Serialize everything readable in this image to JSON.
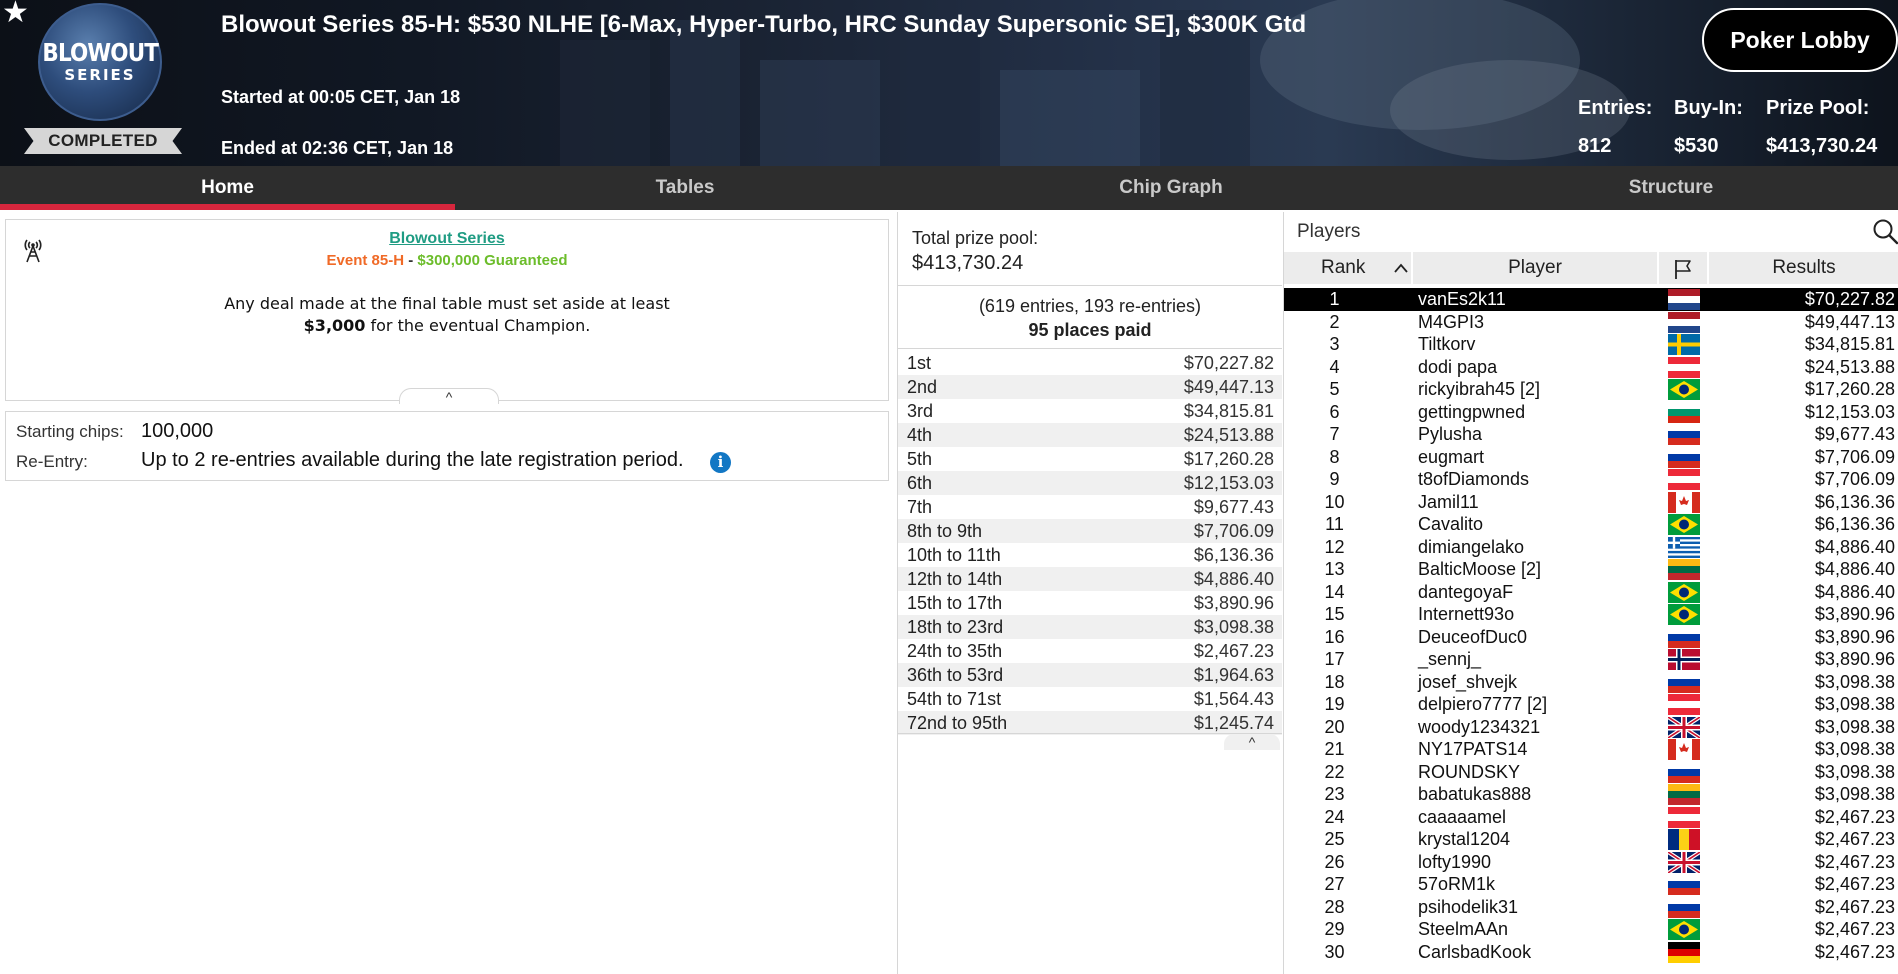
{
  "header": {
    "logo_top": "BLOWOUT",
    "logo_bottom": "SERIES",
    "status": "COMPLETED",
    "title": "Blowout Series 85-H: $530 NLHE [6-Max, Hyper-Turbo, HRC Sunday Supersonic SE], $300K Gtd",
    "started": "Started at 00:05 CET, Jan 18",
    "ended": "Ended at 02:36 CET, Jan 18",
    "lobby_button": "Poker Lobby",
    "stats": {
      "entries_label": "Entries:",
      "entries_value": "812",
      "buyin_label": "Buy-In:",
      "buyin_value": "$530",
      "prizepool_label": "Prize Pool:",
      "prizepool_value": "$413,730.24"
    }
  },
  "nav": {
    "tabs": [
      {
        "label": "Home",
        "active": true
      },
      {
        "label": "Tables",
        "active": false
      },
      {
        "label": "Chip Graph",
        "active": false
      },
      {
        "label": "Structure",
        "active": false
      }
    ]
  },
  "info": {
    "series_link": "Blowout Series",
    "event_name": "Event 85-H",
    "event_sep": " - ",
    "guarantee": "$300,000 Guaranteed",
    "deal_line1": "Any deal made at the final table must set aside at least",
    "deal_amount": "$3,000",
    "deal_line2": " for the eventual Champion.",
    "collapse_glyph": "^"
  },
  "details": {
    "starting_chips_label": "Starting chips:",
    "starting_chips_value": "100,000",
    "reentry_label": "Re-Entry:",
    "reentry_value": "Up to 2 re-entries available during the late registration period.",
    "info_glyph": "i"
  },
  "prize": {
    "total_label": "Total prize pool:",
    "total_value": "$413,730.24",
    "entries_text": "(619 entries, 193 re-entries)",
    "places_paid": "95 places paid",
    "collapse_glyph": "^",
    "payouts": [
      {
        "place": "1st",
        "amount": "$70,227.82"
      },
      {
        "place": "2nd",
        "amount": "$49,447.13"
      },
      {
        "place": "3rd",
        "amount": "$34,815.81"
      },
      {
        "place": "4th",
        "amount": "$24,513.88"
      },
      {
        "place": "5th",
        "amount": "$17,260.28"
      },
      {
        "place": "6th",
        "amount": "$12,153.03"
      },
      {
        "place": "7th",
        "amount": "$9,677.43"
      },
      {
        "place": "8th to 9th",
        "amount": "$7,706.09"
      },
      {
        "place": "10th to 11th",
        "amount": "$6,136.36"
      },
      {
        "place": "12th to 14th",
        "amount": "$4,886.40"
      },
      {
        "place": "15th to 17th",
        "amount": "$3,890.96"
      },
      {
        "place": "18th to 23rd",
        "amount": "$3,098.38"
      },
      {
        "place": "24th to 35th",
        "amount": "$2,467.23"
      },
      {
        "place": "36th to 53rd",
        "amount": "$1,964.63"
      },
      {
        "place": "54th to 71st",
        "amount": "$1,564.43"
      },
      {
        "place": "72nd to 95th",
        "amount": "$1,245.74"
      }
    ]
  },
  "players": {
    "label": "Players",
    "columns": {
      "rank": "Rank",
      "player": "Player",
      "results": "Results"
    },
    "rows": [
      {
        "rank": "1",
        "name": "vanEs2k11",
        "flag": "NL",
        "result": "$70,227.82",
        "selected": true
      },
      {
        "rank": "2",
        "name": "M4GPI3",
        "flag": "NL",
        "result": "$49,447.13"
      },
      {
        "rank": "3",
        "name": "Tiltkorv",
        "flag": "SE",
        "result": "$34,815.81"
      },
      {
        "rank": "4",
        "name": "dodi papa",
        "flag": "AT",
        "result": "$24,513.88"
      },
      {
        "rank": "5",
        "name": "rickyibrah45 [2]",
        "flag": "BR",
        "result": "$17,260.28"
      },
      {
        "rank": "6",
        "name": "gettingpwned",
        "flag": "BG",
        "result": "$12,153.03"
      },
      {
        "rank": "7",
        "name": "Pylusha",
        "flag": "RU",
        "result": "$9,677.43"
      },
      {
        "rank": "8",
        "name": "eugmart",
        "flag": "RU",
        "result": "$7,706.09"
      },
      {
        "rank": "9",
        "name": "t8ofDiamonds",
        "flag": "AT",
        "result": "$7,706.09"
      },
      {
        "rank": "10",
        "name": "Jamil11",
        "flag": "CA",
        "result": "$6,136.36"
      },
      {
        "rank": "11",
        "name": "Cavalito",
        "flag": "BR",
        "result": "$6,136.36"
      },
      {
        "rank": "12",
        "name": "dimiangelako",
        "flag": "GR",
        "result": "$4,886.40"
      },
      {
        "rank": "13",
        "name": "BalticMoose [2]",
        "flag": "LT",
        "result": "$4,886.40"
      },
      {
        "rank": "14",
        "name": "dantegoyaF",
        "flag": "BR",
        "result": "$4,886.40"
      },
      {
        "rank": "15",
        "name": "Internett93o",
        "flag": "BR",
        "result": "$3,890.96"
      },
      {
        "rank": "16",
        "name": "DeuceofDuc0",
        "flag": "RU",
        "result": "$3,890.96"
      },
      {
        "rank": "17",
        "name": "_sennj_",
        "flag": "NO",
        "result": "$3,890.96"
      },
      {
        "rank": "18",
        "name": "josef_shvejk",
        "flag": "RU",
        "result": "$3,098.38"
      },
      {
        "rank": "19",
        "name": "delpiero7777 [2]",
        "flag": "AT",
        "result": "$3,098.38"
      },
      {
        "rank": "20",
        "name": "woody1234321",
        "flag": "GB",
        "result": "$3,098.38"
      },
      {
        "rank": "21",
        "name": "NY17PATS14",
        "flag": "CA",
        "result": "$3,098.38"
      },
      {
        "rank": "22",
        "name": "ROUNDSKY",
        "flag": "RU",
        "result": "$3,098.38"
      },
      {
        "rank": "23",
        "name": "babatukas888",
        "flag": "LT",
        "result": "$3,098.38"
      },
      {
        "rank": "24",
        "name": "caaaaamel",
        "flag": "AT",
        "result": "$2,467.23"
      },
      {
        "rank": "25",
        "name": "krystal1204",
        "flag": "RO",
        "result": "$2,467.23"
      },
      {
        "rank": "26",
        "name": "lofty1990",
        "flag": "GB",
        "result": "$2,467.23"
      },
      {
        "rank": "27",
        "name": "57oRM1k",
        "flag": "RU",
        "result": "$2,467.23"
      },
      {
        "rank": "28",
        "name": "psihodelik31",
        "flag": "RU",
        "result": "$2,467.23"
      },
      {
        "rank": "29",
        "name": "SteelmAAn",
        "flag": "BR",
        "result": "$2,467.23"
      },
      {
        "rank": "30",
        "name": "CarlsbadKook",
        "flag": "DE",
        "result": "$2,467.23"
      }
    ]
  },
  "colors": {
    "accent_red": "#d7263d",
    "link_teal": "#1f9c83",
    "event_orange": "#f06a27",
    "guarantee_green": "#6cbd2b",
    "info_blue": "#1277c4"
  }
}
